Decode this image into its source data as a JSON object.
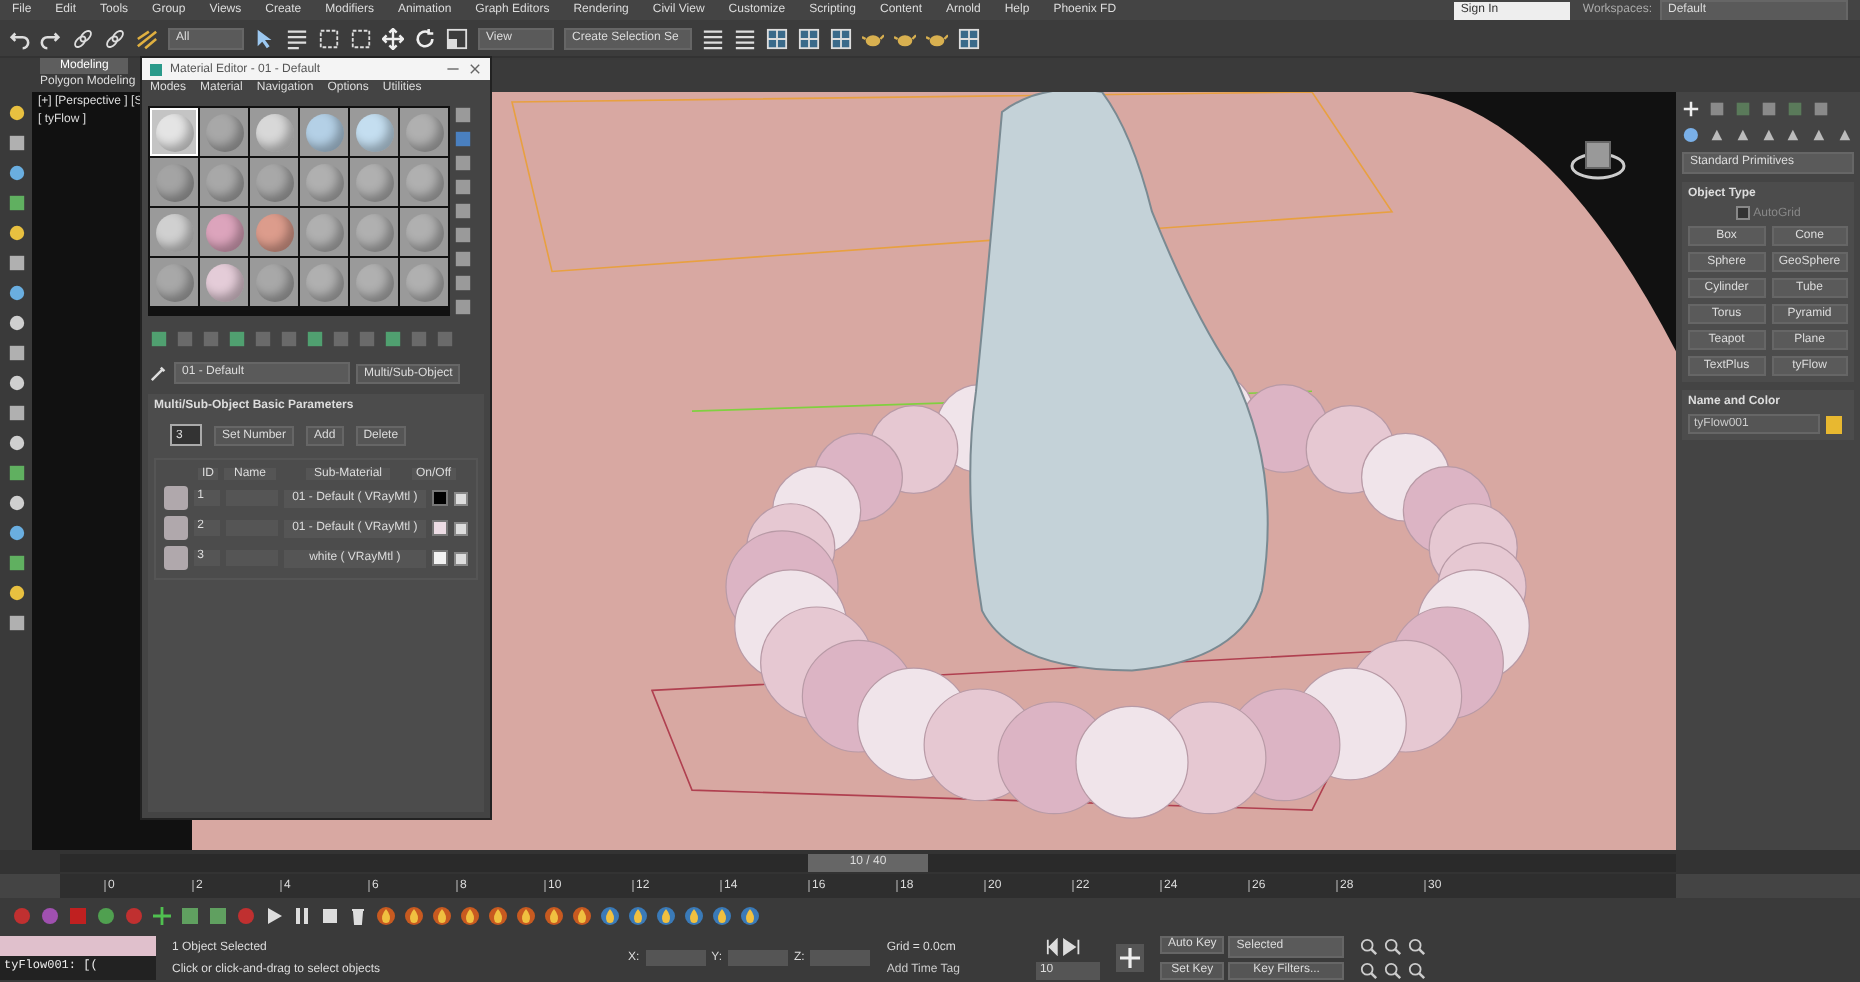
{
  "menu_bar": {
    "items": [
      "File",
      "Edit",
      "Tools",
      "Group",
      "Views",
      "Create",
      "Modifiers",
      "Animation",
      "Graph Editors",
      "Rendering",
      "Civil View",
      "Customize",
      "Scripting",
      "Content",
      "Arnold",
      "Help",
      "Phoenix FD"
    ],
    "sign_in": "Sign In",
    "workspace_label": "Workspaces:",
    "workspace": "Default"
  },
  "toolbar": {
    "selection_filter": "All",
    "reference_coord": "View",
    "selection_set": "Create Selection Se"
  },
  "ribbon": {
    "tabs": [
      {
        "label": "Modeling",
        "selected": true
      }
    ],
    "panel": "Polygon Modeling"
  },
  "viewport": {
    "labels": [
      "[+] [Perspective ] [S",
      "[ tyFlow ]"
    ]
  },
  "material_editor": {
    "title": "Material Editor - 01 - Default",
    "menus": [
      "Modes",
      "Material",
      "Navigation",
      "Options",
      "Utilities"
    ],
    "slots": [
      {
        "color": "#e4e4e4",
        "selected": true
      },
      {
        "color": "#a8a8a8",
        "selected": false
      },
      {
        "color": "#d8d8d8",
        "selected": false
      },
      {
        "color": "#b4d0e6",
        "selected": false
      },
      {
        "color": "#c4def0",
        "selected": false
      },
      {
        "color": "#b0b0b0",
        "selected": false
      },
      {
        "color": "#a4a4a4",
        "selected": false
      },
      {
        "color": "#a8a8a8",
        "selected": false
      },
      {
        "color": "#a8a8a8",
        "selected": false
      },
      {
        "color": "#b0b0b0",
        "selected": false
      },
      {
        "color": "#b0b0b0",
        "selected": false
      },
      {
        "color": "#b0b0b0",
        "selected": false
      },
      {
        "color": "#d0d0d0",
        "selected": false
      },
      {
        "color": "#dca4bc",
        "selected": false
      },
      {
        "color": "#dc9c8c",
        "selected": false
      },
      {
        "color": "#b0b0b0",
        "selected": false
      },
      {
        "color": "#b0b0b0",
        "selected": false
      },
      {
        "color": "#b0b0b0",
        "selected": false
      },
      {
        "color": "#a8a8a8",
        "selected": false
      },
      {
        "color": "#e4ccd8",
        "selected": false
      },
      {
        "color": "#a8a8a8",
        "selected": false
      },
      {
        "color": "#b0b0b0",
        "selected": false
      },
      {
        "color": "#b0b0b0",
        "selected": false
      },
      {
        "color": "#b0b0b0",
        "selected": false
      }
    ],
    "material_name": "01 - Default",
    "material_type": "Multi/Sub-Object",
    "rollout": "Multi/Sub-Object Basic Parameters",
    "count": "3",
    "buttons": [
      "Set Number",
      "Add",
      "Delete"
    ],
    "columns": [
      "ID",
      "Name",
      "Sub-Material",
      "On/Off"
    ],
    "rows": [
      {
        "id": "1",
        "sub_material": "01 - Default  ( VRayMtl )",
        "color": "#000000",
        "checked": true
      },
      {
        "id": "2",
        "sub_material": "01 - Default  ( VRayMtl )",
        "color": "#ecdce4",
        "checked": true
      },
      {
        "id": "3",
        "sub_material": "white  ( VRayMtl )",
        "color": "#f2f2f2",
        "checked": true
      }
    ]
  },
  "command_panel": {
    "dropdown": "Standard Primitives",
    "object_type": {
      "title": "Object Type",
      "autogrid": {
        "label": "AutoGrid",
        "checked": false
      },
      "buttons": [
        "Box",
        "Cone",
        "Sphere",
        "GeoSphere",
        "Cylinder",
        "Tube",
        "Torus",
        "Pyramid",
        "Teapot",
        "Plane",
        "TextPlus",
        "tyFlow"
      ]
    },
    "name_and_color": {
      "title": "Name and Color",
      "name": "tyFlow001",
      "color": "#e8b830"
    }
  },
  "timeline": {
    "frame": "10 / 40",
    "level": 0.5,
    "ticks": [
      "0",
      "2",
      "4",
      "6",
      "8",
      "10",
      "12",
      "14",
      "16",
      "18",
      "20",
      "22",
      "24",
      "26",
      "28",
      "30"
    ]
  },
  "status_bar": {
    "object_name": "tyFlow001: [(",
    "selection": "1 Object Selected",
    "prompt": "Click or click-and-drag to select objects",
    "coords": [
      "X:",
      "Y:",
      "Z:"
    ],
    "grid": "Grid = 0.0cm",
    "time_tag": "Add Time Tag",
    "auto_key": "Auto Key",
    "key_mode": "Selected",
    "set_key": "Set Key",
    "key_filters": "Key Filters...",
    "current_frame": "10"
  }
}
